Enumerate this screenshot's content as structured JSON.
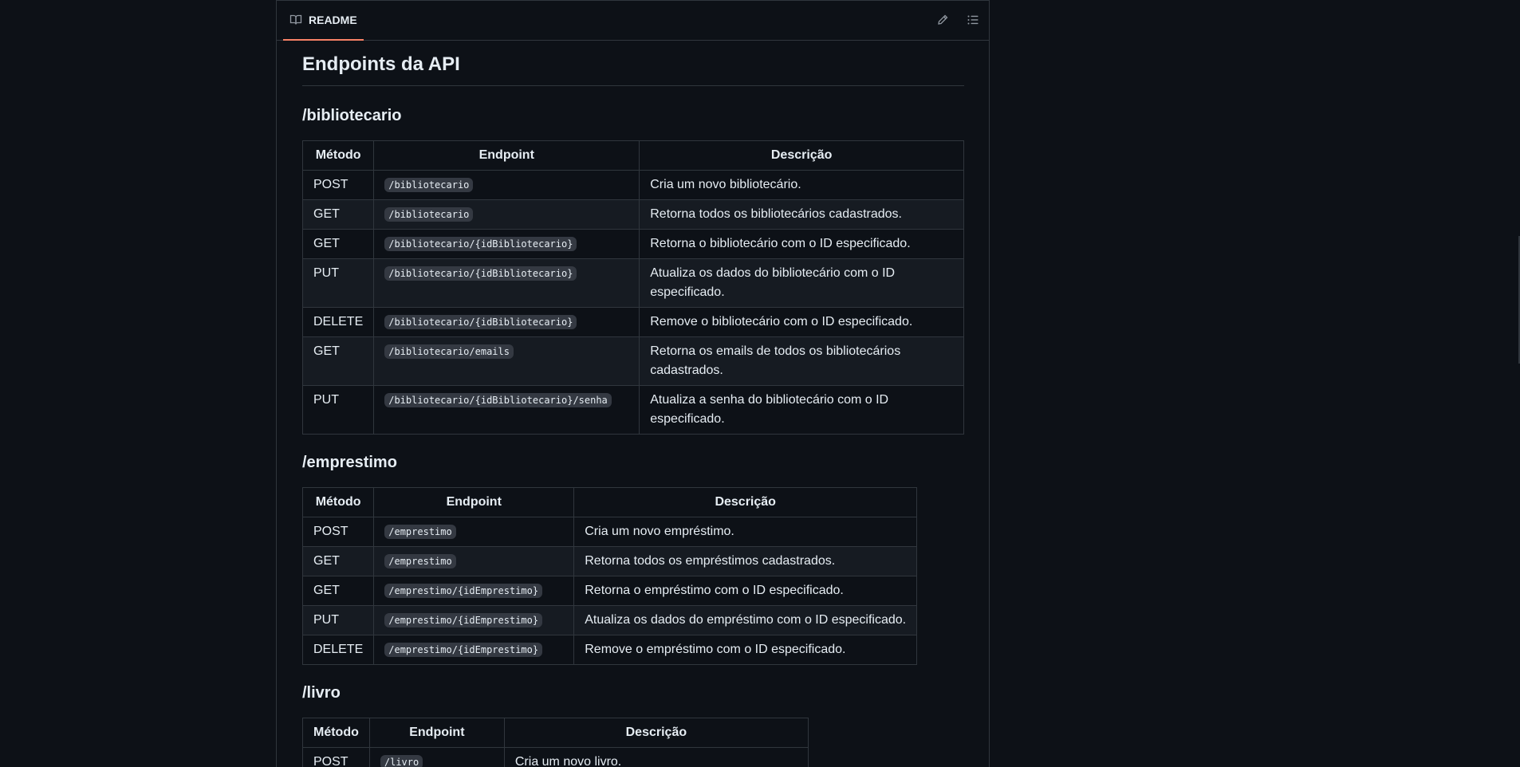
{
  "readme_header": {
    "tab_label": "README",
    "edit_icon": "pencil-icon",
    "toc_icon": "list-unordered-icon",
    "book_icon": "book-icon"
  },
  "colors": {
    "background": "#0d1117",
    "border": "#30363d",
    "accent_underline": "#f78166",
    "code_bg": "#343942"
  },
  "page_title": "Endpoints da API",
  "sections": [
    {
      "heading": "/bibliotecario",
      "columns": [
        "Método",
        "Endpoint",
        "Descrição"
      ],
      "rows": [
        {
          "method": "POST",
          "endpoint": "/bibliotecario",
          "desc": "Cria um novo bibliotecário."
        },
        {
          "method": "GET",
          "endpoint": "/bibliotecario",
          "desc": "Retorna todos os bibliotecários cadastrados."
        },
        {
          "method": "GET",
          "endpoint": "/bibliotecario/{idBibliotecario}",
          "desc": "Retorna o bibliotecário com o ID especificado."
        },
        {
          "method": "PUT",
          "endpoint": "/bibliotecario/{idBibliotecario}",
          "desc": "Atualiza os dados do bibliotecário com o ID especificado."
        },
        {
          "method": "DELETE",
          "endpoint": "/bibliotecario/{idBibliotecario}",
          "desc": "Remove o bibliotecário com o ID especificado."
        },
        {
          "method": "GET",
          "endpoint": "/bibliotecario/emails",
          "desc": "Retorna os emails de todos os bibliotecários cadastrados."
        },
        {
          "method": "PUT",
          "endpoint": "/bibliotecario/{idBibliotecario}/senha",
          "desc": "Atualiza a senha do bibliotecário com o ID especificado."
        }
      ]
    },
    {
      "heading": "/emprestimo",
      "columns": [
        "Método",
        "Endpoint",
        "Descrição"
      ],
      "rows": [
        {
          "method": "POST",
          "endpoint": "/emprestimo",
          "desc": "Cria um novo empréstimo."
        },
        {
          "method": "GET",
          "endpoint": "/emprestimo",
          "desc": "Retorna todos os empréstimos cadastrados."
        },
        {
          "method": "GET",
          "endpoint": "/emprestimo/{idEmprestimo}",
          "desc": "Retorna o empréstimo com o ID especificado."
        },
        {
          "method": "PUT",
          "endpoint": "/emprestimo/{idEmprestimo}",
          "desc": "Atualiza os dados do empréstimo com o ID especificado."
        },
        {
          "method": "DELETE",
          "endpoint": "/emprestimo/{idEmprestimo}",
          "desc": "Remove o empréstimo com o ID especificado."
        }
      ]
    },
    {
      "heading": "/livro",
      "columns": [
        "Método",
        "Endpoint",
        "Descrição"
      ],
      "rows": [
        {
          "method": "POST",
          "endpoint": "/livro",
          "desc": "Cria um novo livro."
        }
      ]
    }
  ]
}
